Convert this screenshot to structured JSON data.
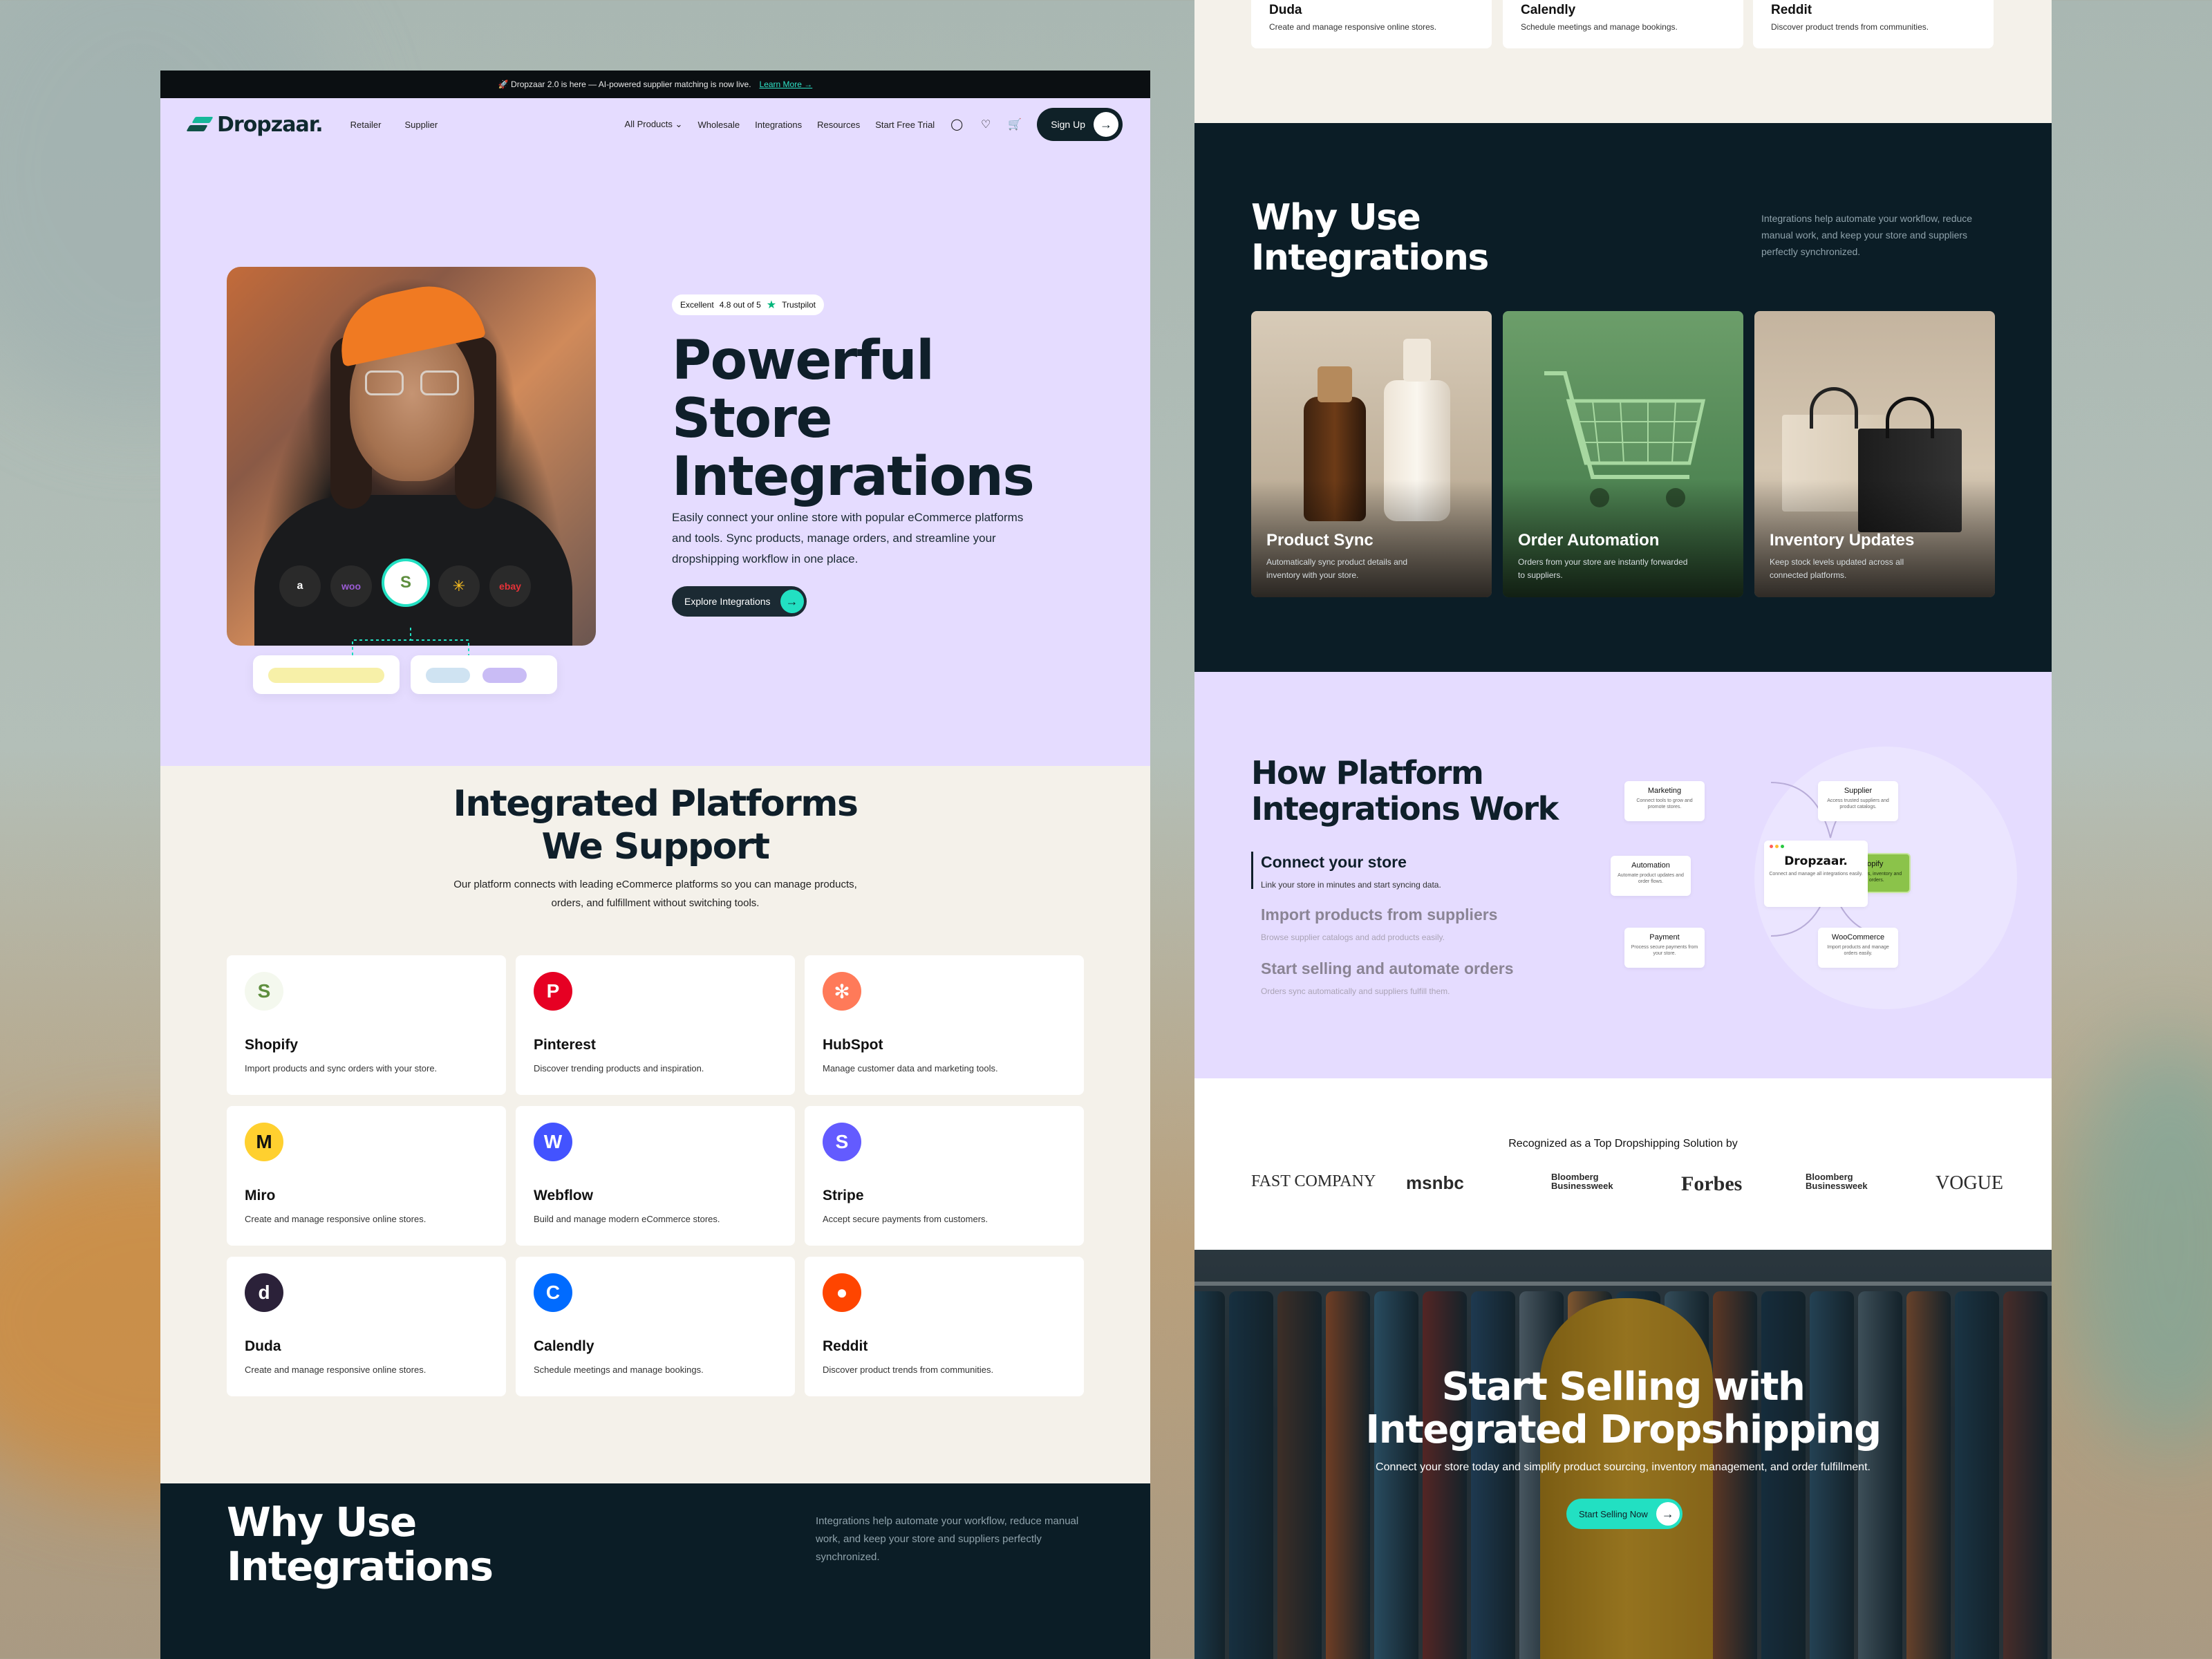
{
  "colors": {
    "accent": "#22e0c2",
    "brand_dark": "#0f2128",
    "lavender": "#e5dcff",
    "cream": "#f4f1ea",
    "navy": "#0b1d26"
  },
  "announcement": {
    "text": "🚀 Dropzaar 2.0 is here — AI-powered supplier matching is now live.",
    "link": "Learn More →"
  },
  "nav": {
    "logo": "Dropzaar.",
    "left_links": [
      "Retailer",
      "Supplier"
    ],
    "right_links": [
      "All Products",
      "Wholesale",
      "Integrations",
      "Resources",
      "Start Free Trial"
    ],
    "all_products_chevron": "⌄",
    "icons": [
      "user-icon",
      "heart-icon",
      "cart-icon"
    ],
    "signup": "Sign Up"
  },
  "hero": {
    "trust_excellent": "Excellent",
    "trust_rating": "4.8 out of 5",
    "trust_brand": "Trustpilot",
    "title_lines": [
      "Powerful",
      "Store",
      "Integrations"
    ],
    "subtitle": "Easily connect your online store with popular eCommerce platforms and tools. Sync products, manage orders, and streamline your dropshipping workflow in one place.",
    "cta": "Explore Integrations",
    "platform_chips": [
      "a",
      "woo",
      "S",
      "✳",
      "ebay"
    ]
  },
  "platforms": {
    "title_lines": [
      "Integrated Platforms",
      "We Support"
    ],
    "subtitle": "Our platform connects with leading eCommerce platforms so you can manage products, orders, and fulfillment without switching tools.",
    "items": [
      {
        "name": "Shopify",
        "desc": "Import products and sync orders with your store.",
        "glyph": "S",
        "color": "#95bf47"
      },
      {
        "name": "Pinterest",
        "desc": "Discover trending products and inspiration.",
        "glyph": "P",
        "color": "#e60023"
      },
      {
        "name": "HubSpot",
        "desc": "Manage customer data and marketing tools.",
        "glyph": "✻",
        "color": "#ff7a59"
      },
      {
        "name": "Miro",
        "desc": "Create and manage responsive online stores.",
        "glyph": "M",
        "color": "#ffd02f"
      },
      {
        "name": "Webflow",
        "desc": "Build and manage modern eCommerce stores.",
        "glyph": "W",
        "color": "#4353ff"
      },
      {
        "name": "Stripe",
        "desc": "Accept secure payments from customers.",
        "glyph": "S",
        "color": "#635bff"
      },
      {
        "name": "Duda",
        "desc": "Create and manage responsive online stores.",
        "glyph": "d",
        "color": "#2b2139"
      },
      {
        "name": "Calendly",
        "desc": "Schedule meetings and manage bookings.",
        "glyph": "C",
        "color": "#006bff"
      },
      {
        "name": "Reddit",
        "desc": "Discover product trends from communities.",
        "glyph": "●",
        "color": "#ff4500"
      }
    ]
  },
  "why": {
    "title_lines": [
      "Why Use",
      "Integrations"
    ],
    "side": "Integrations help automate your workflow, reduce manual work, and keep your store and suppliers perfectly synchronized.",
    "features": [
      {
        "title": "Product Sync",
        "desc": "Automatically sync product details and inventory with your store."
      },
      {
        "title": "Order Automation",
        "desc": "Orders from your store are instantly forwarded to suppliers."
      },
      {
        "title": "Inventory Updates",
        "desc": "Keep stock levels updated across all connected platforms."
      }
    ]
  },
  "how": {
    "title_lines": [
      "How Platform",
      "Integrations Work"
    ],
    "steps": [
      {
        "title": "Connect your store",
        "desc": "Link your store in minutes and start syncing data."
      },
      {
        "title": "Import products from suppliers",
        "desc": "Browse supplier catalogs and add products easily."
      },
      {
        "title": "Start selling and automate orders",
        "desc": "Orders sync automatically and suppliers fulfill them."
      }
    ],
    "center": {
      "name": "Dropzaar.",
      "desc": "Connect and manage all integrations easily."
    },
    "nodes": [
      {
        "name": "Marketing",
        "desc": "Connect tools to grow and promote stores."
      },
      {
        "name": "Supplier",
        "desc": "Access trusted suppliers and product catalogs."
      },
      {
        "name": "Automation",
        "desc": "Automate product updates and order flows."
      },
      {
        "name": "Shopify",
        "desc": "Sync products, inventory and store orders."
      },
      {
        "name": "Payment",
        "desc": "Process secure payments from your store."
      },
      {
        "name": "WooCommerce",
        "desc": "Import products and manage orders easily."
      }
    ]
  },
  "recognized": {
    "title": "Recognized as a Top Dropshipping Solution by",
    "brands": [
      "FAST COMPANY",
      "msnbc",
      "Bloomberg Businessweek",
      "Forbes",
      "Bloomberg Businessweek",
      "VOGUE"
    ]
  },
  "cta": {
    "title_lines": [
      "Start Selling with",
      "Integrated Dropshipping"
    ],
    "subtitle": "Connect your store today and simplify product sourcing, inventory management, and order fulfillment.",
    "button": "Start Selling Now"
  }
}
